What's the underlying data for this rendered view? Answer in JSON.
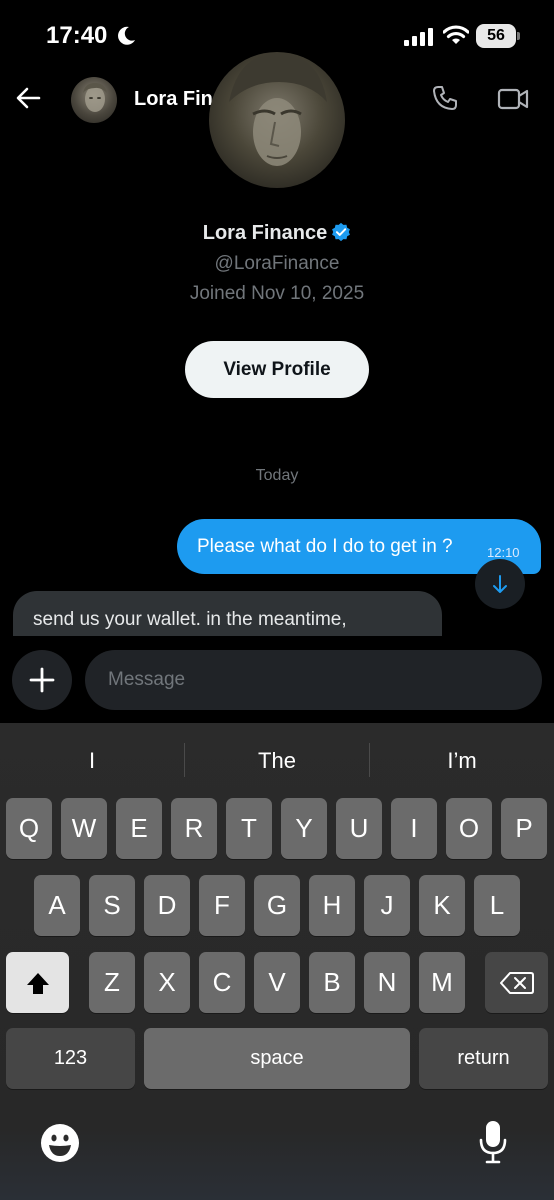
{
  "status_bar": {
    "time": "17:40",
    "battery": "56"
  },
  "header": {
    "name": "Lora Finance"
  },
  "profile": {
    "name": "Lora Finance",
    "handle": "@LoraFinance",
    "joined": "Joined Nov 10, 2025",
    "view_profile_label": "View Profile"
  },
  "conversation": {
    "date_label": "Today",
    "messages": [
      {
        "direction": "outgoing",
        "text": "Please what do I do to get in ?",
        "time": "12:10"
      },
      {
        "direction": "incoming",
        "text": "send us your wallet. in the meantime,"
      }
    ]
  },
  "composer": {
    "placeholder": "Message"
  },
  "keyboard": {
    "suggestions": [
      "I",
      "The",
      "I’m"
    ],
    "row1": [
      "Q",
      "W",
      "E",
      "R",
      "T",
      "Y",
      "U",
      "I",
      "O",
      "P"
    ],
    "row2": [
      "A",
      "S",
      "D",
      "F",
      "G",
      "H",
      "J",
      "K",
      "L"
    ],
    "row3": [
      "Z",
      "X",
      "C",
      "V",
      "B",
      "N",
      "M"
    ],
    "numbers_label": "123",
    "space_label": "space",
    "return_label": "return"
  },
  "colors": {
    "accent": "#1d9bf0",
    "background": "#000000",
    "incoming_bubble": "#2f3336",
    "muted_text": "#71767b"
  },
  "icons": {
    "status": [
      "moon-icon",
      "signal-icon",
      "wifi-icon",
      "battery-icon"
    ],
    "header": [
      "back-icon",
      "verified-icon",
      "phone-icon",
      "video-icon"
    ],
    "keyboard": [
      "shift-icon",
      "delete-icon",
      "emoji-icon",
      "mic-icon"
    ]
  }
}
